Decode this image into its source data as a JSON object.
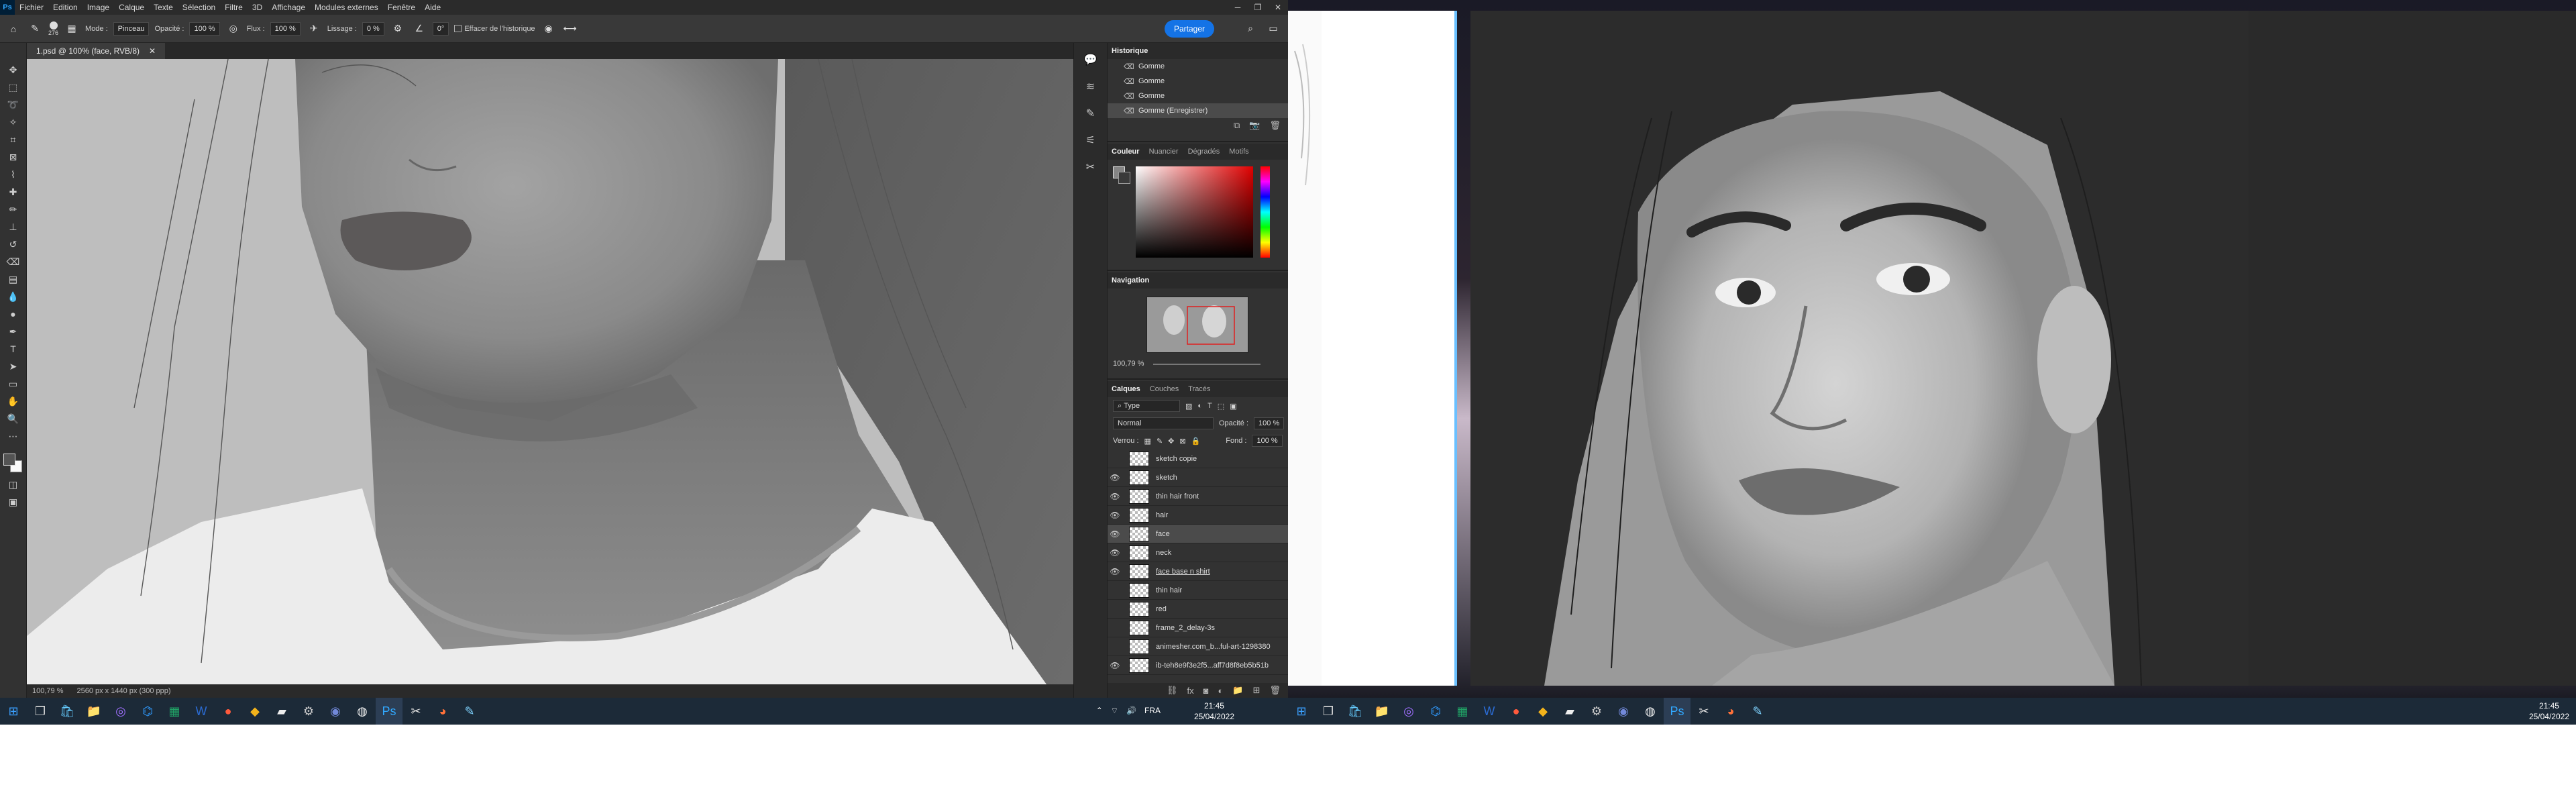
{
  "menubar": {
    "logo": "Ps",
    "items": [
      "Fichier",
      "Edition",
      "Image",
      "Calque",
      "Texte",
      "Sélection",
      "Filtre",
      "3D",
      "Affichage",
      "Modules externes",
      "Fenêtre",
      "Aide"
    ]
  },
  "options": {
    "brush_size": "276",
    "mode_label": "Mode :",
    "mode_value": "Pinceau",
    "opacity_label": "Opacité :",
    "opacity_value": "100 %",
    "flow_label": "Flux :",
    "flow_value": "100 %",
    "smoothing_label": "Lissage :",
    "smoothing_value": "0 %",
    "angle_value": "0°",
    "erase_history_label": "Effacer de l'historique",
    "share_label": "Partager"
  },
  "document": {
    "tab_title": "1.psd @ 100% (face, RVB/8)",
    "zoom": "100,79 %",
    "doc_info": "2560 px x 1440 px (300 ppp)"
  },
  "history": {
    "title": "Historique",
    "items": [
      {
        "label": "Gomme"
      },
      {
        "label": "Gomme"
      },
      {
        "label": "Gomme"
      },
      {
        "label": "Gomme (Enregistrer)"
      }
    ]
  },
  "color_panel": {
    "tabs": [
      "Couleur",
      "Nuancier",
      "Dégradés",
      "Motifs"
    ]
  },
  "navigation": {
    "title": "Navigation",
    "zoom": "100,79 %"
  },
  "layers": {
    "tabs": [
      "Calques",
      "Couches",
      "Tracés"
    ],
    "filter_kind": "Type",
    "blend_mode": "Normal",
    "opacity_label": "Opacité :",
    "opacity_value": "100 %",
    "lock_label": "Verrou :",
    "fill_label": "Fond :",
    "fill_value": "100 %",
    "items": [
      {
        "name": "sketch copie",
        "visible": false
      },
      {
        "name": "sketch",
        "visible": true
      },
      {
        "name": "thin hair front",
        "visible": true
      },
      {
        "name": "hair",
        "visible": true
      },
      {
        "name": "face",
        "visible": true,
        "selected": true
      },
      {
        "name": "neck",
        "visible": true
      },
      {
        "name": "face base n shirt",
        "visible": true
      },
      {
        "name": "thin hair",
        "visible": false
      },
      {
        "name": "red",
        "visible": false
      },
      {
        "name": "frame_2_delay-3s",
        "visible": false
      },
      {
        "name": "animesher.com_b...ful-art-1298380",
        "visible": false
      },
      {
        "name": "ib-teh8e9f3e2f5...aff7d8f8eb5b51b",
        "visible": true
      }
    ]
  },
  "taskbar_left": {
    "lang": "FRA",
    "time": "21:45",
    "date": "25/04/2022"
  },
  "taskbar_right": {
    "time": "21:45",
    "date": "25/04/2022"
  }
}
